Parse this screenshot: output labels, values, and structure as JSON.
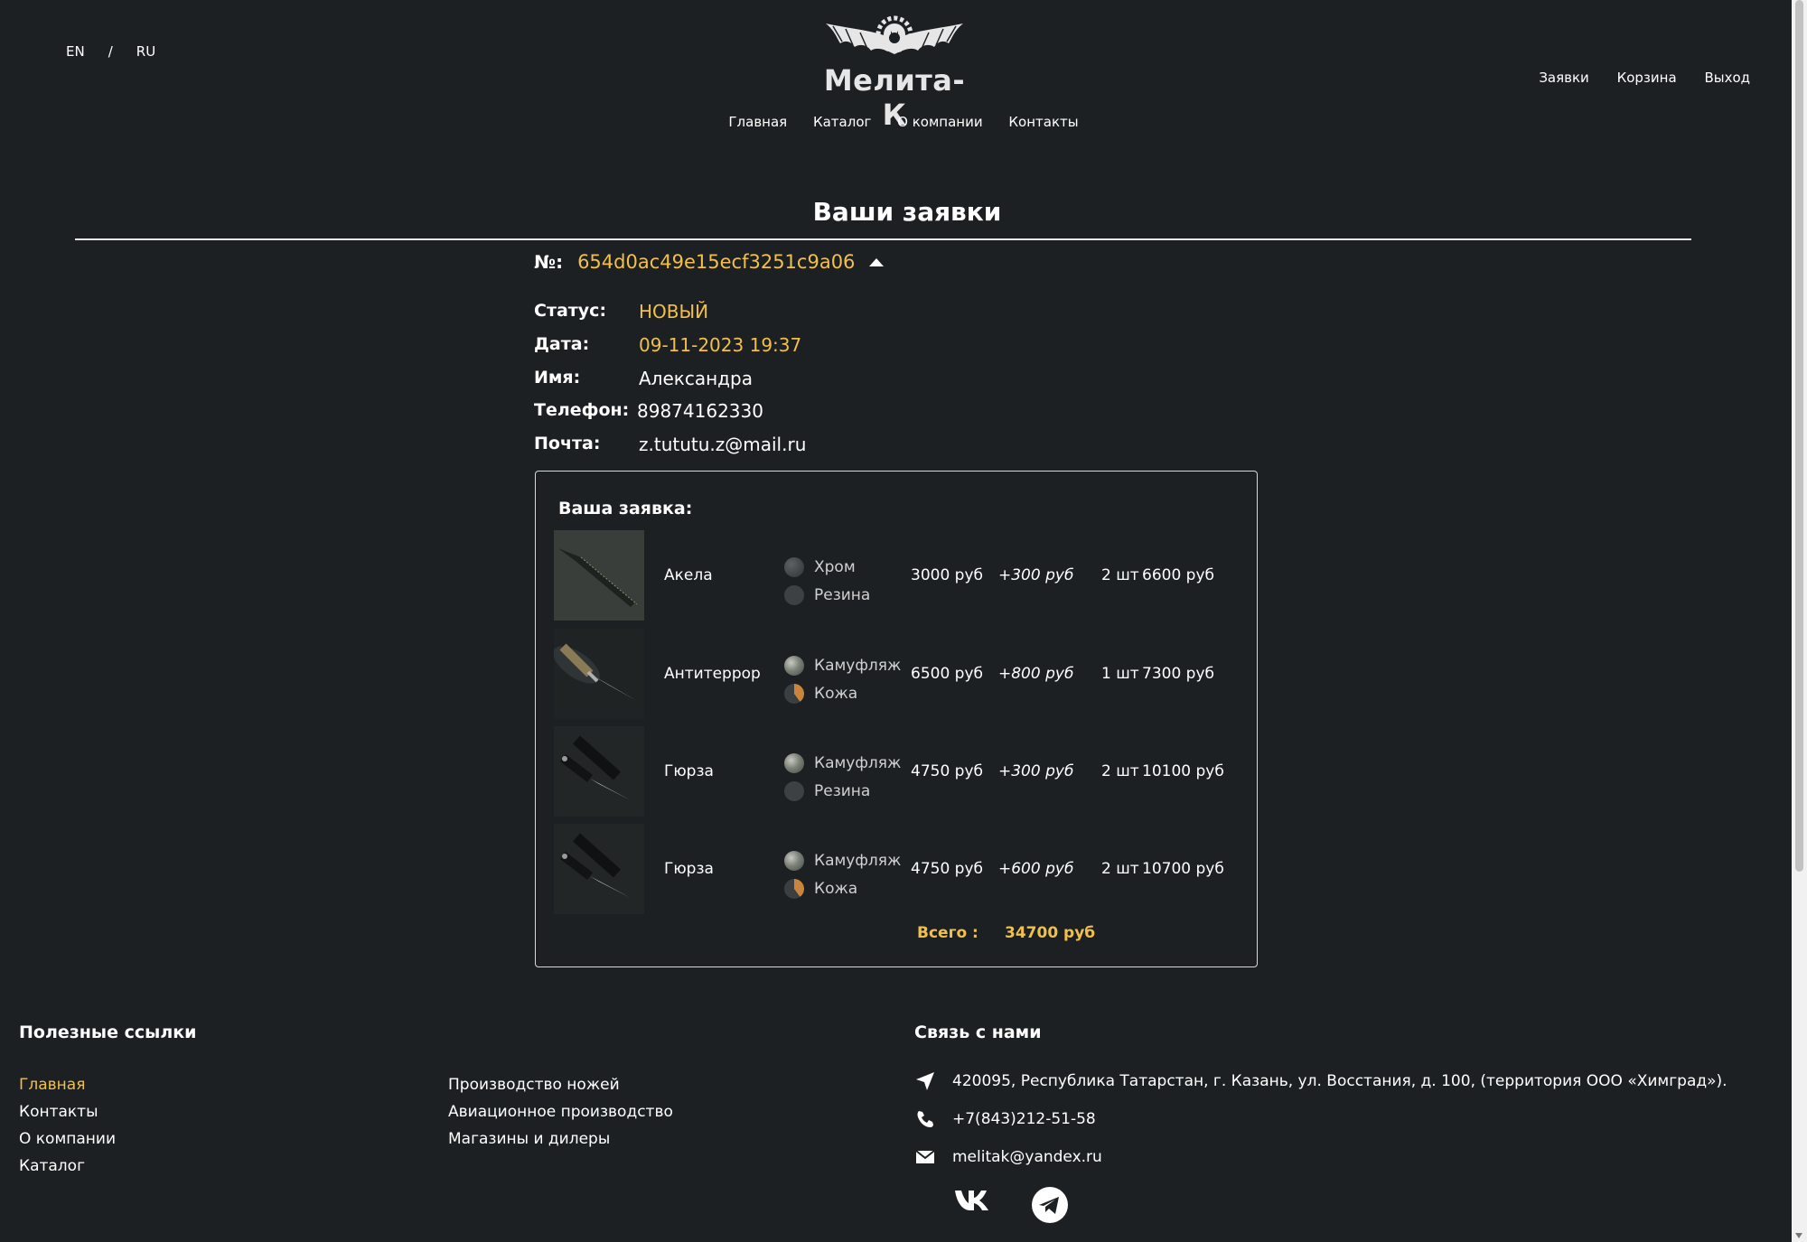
{
  "header": {
    "lang_en": "EN",
    "lang_sep": "/",
    "lang_ru": "RU",
    "brand": "Мелита-К",
    "nav": [
      "Главная",
      "Каталог",
      "О компании",
      "Контакты"
    ],
    "user_nav": [
      "Заявки",
      "Корзина",
      "Выход"
    ]
  },
  "page": {
    "title": "Ваши заявки"
  },
  "order": {
    "number_label": "№:",
    "number": "654d0ac49e15ecf3251c9a06",
    "status_label": "Статус:",
    "status": "НОВЫЙ",
    "date_label": "Дата:",
    "date": "09-11-2023 19:37",
    "name_label": "Имя:",
    "name": "Александра",
    "phone_label": "Телефон:",
    "phone": "89874162330",
    "email_label": "Почта:",
    "email": "z.tututu.z@mail.ru"
  },
  "items_box": {
    "title": "Ваша заявка:",
    "items": [
      {
        "name": "Акела",
        "opt1": "Хром",
        "opt1_icon": "chrome",
        "opt2": "Резина",
        "opt2_icon": "rubber",
        "price": "3000 руб",
        "extra": "+300 руб",
        "qty": "2 шт",
        "sum": "6600 руб"
      },
      {
        "name": "Антитеррор",
        "opt1": "Камуфляж",
        "opt1_icon": "camo",
        "opt2": "Кожа",
        "opt2_icon": "leather",
        "price": "6500 руб",
        "extra": "+800 руб",
        "qty": "1 шт",
        "sum": "7300 руб"
      },
      {
        "name": "Гюрза",
        "opt1": "Камуфляж",
        "opt1_icon": "camo",
        "opt2": "Резина",
        "opt2_icon": "rubber",
        "price": "4750 руб",
        "extra": "+300 руб",
        "qty": "2 шт",
        "sum": "10100 руб"
      },
      {
        "name": "Гюрза",
        "opt1": "Камуфляж",
        "opt1_icon": "camo",
        "opt2": "Кожа",
        "opt2_icon": "leather",
        "price": "4750 руб",
        "extra": "+600 руб",
        "qty": "2 шт",
        "sum": "10700 руб"
      }
    ],
    "total_label": "Всего :",
    "total": "34700 руб"
  },
  "footer": {
    "links_title": "Полезные ссылки",
    "links_col1": [
      "Главная",
      "Контакты",
      "О компании",
      "Каталог"
    ],
    "links_col2": [
      "Производство ножей",
      "Авиационное производство",
      "Магазины и дилеры"
    ],
    "contact_title": "Связь с нами",
    "address": "420095, Республика Татарстан, г. Казань, ул. Восстания, д. 100, (территория ООО «Химград»).",
    "phone": "+7(843)212-51-58",
    "email": "melitak@yandex.ru"
  },
  "colors": {
    "background": "#1c2022",
    "accent": "#f2c04a",
    "text": "#ffffff"
  },
  "icons": [
    "bat-logo-icon",
    "chevron-up-icon",
    "location-arrow-icon",
    "phone-icon",
    "envelope-icon",
    "vk-icon",
    "telegram-icon"
  ]
}
